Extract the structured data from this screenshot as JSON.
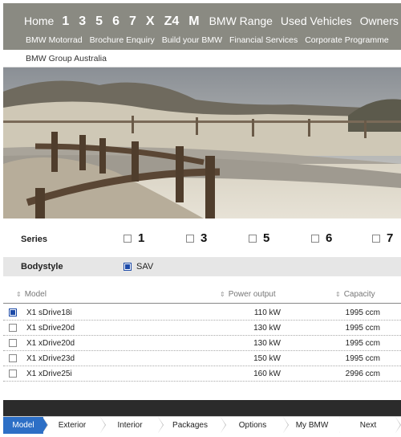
{
  "nav": {
    "home": "Home",
    "series": [
      "1",
      "3",
      "5",
      "6",
      "7",
      "X",
      "Z4",
      "M"
    ],
    "links": [
      "BMW Range",
      "Used Vehicles",
      "Owners"
    ]
  },
  "subnav": [
    "BMW Motorrad",
    "Brochure Enquiry",
    "Build your BMW",
    "Financial Services",
    "Corporate Programme"
  ],
  "group": "BMW Group Australia",
  "series_filter": {
    "label": "Series",
    "options": [
      {
        "label": "1",
        "checked": false
      },
      {
        "label": "3",
        "checked": false
      },
      {
        "label": "5",
        "checked": false
      },
      {
        "label": "6",
        "checked": false
      },
      {
        "label": "7",
        "checked": false
      }
    ]
  },
  "bodystyle": {
    "label": "Bodystyle",
    "option": "SAV",
    "checked": true
  },
  "table": {
    "headers": {
      "model": "Model",
      "power": "Power output",
      "capacity": "Capacity"
    },
    "rows": [
      {
        "model": "X1 sDrive18i",
        "power": "110 kW",
        "capacity": "1995 ccm",
        "checked": true
      },
      {
        "model": "X1 sDrive20d",
        "power": "130 kW",
        "capacity": "1995 ccm",
        "checked": false
      },
      {
        "model": "X1 xDrive20d",
        "power": "130 kW",
        "capacity": "1995 ccm",
        "checked": false
      },
      {
        "model": "X1 xDrive23d",
        "power": "150 kW",
        "capacity": "1995 ccm",
        "checked": false
      },
      {
        "model": "X1 xDrive25i",
        "power": "160 kW",
        "capacity": "2996 ccm",
        "checked": false
      }
    ]
  },
  "steps": [
    "Model",
    "Exterior",
    "Interior",
    "Packages",
    "Options",
    "My BMW",
    "Next"
  ],
  "active_step": "Model",
  "colors": {
    "nav_bg": "#8a8a82",
    "accent": "#2d6fc6",
    "dark_bar": "#2b2b2b"
  }
}
